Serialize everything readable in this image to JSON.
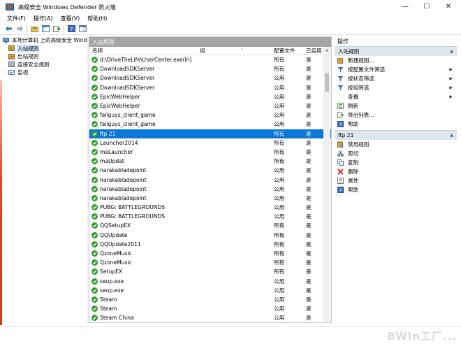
{
  "window": {
    "title": "高级安全 Windows Defender 防火墙",
    "controls": {
      "minimize": "—",
      "maximize": "☐",
      "close": "✕"
    }
  },
  "menu": [
    "文件(F)",
    "操作(A)",
    "查看(V)",
    "帮助(H)"
  ],
  "toolbar": {
    "icons": [
      "back-icon",
      "forward-icon",
      "folder-up-icon",
      "show-hide-tree-icon",
      "export-icon",
      "help-icon",
      "console-pane-icon"
    ]
  },
  "tree": {
    "root": "本地计算机 上的高级安全 Windows Defender 防火墙",
    "items": [
      {
        "label": "入站规则",
        "selected": true
      },
      {
        "label": "出站规则",
        "selected": false
      },
      {
        "label": "连接安全规则",
        "selected": false
      },
      {
        "label": "监视",
        "selected": false
      }
    ]
  },
  "center": {
    "header": "入站规则",
    "columns": {
      "name": "名称",
      "group": "组",
      "profile": "配置文件",
      "enabled": "已启用"
    },
    "rules": [
      {
        "name": "d:\\DriveTheLife\\UserCenter.exe(ln)",
        "group": "",
        "profile": "所有",
        "enabled": "是"
      },
      {
        "name": "DownloadSDKServer",
        "group": "",
        "profile": "所有",
        "enabled": "是"
      },
      {
        "name": "DownloadSDKServer",
        "group": "",
        "profile": "公用",
        "enabled": "是"
      },
      {
        "name": "DownloadSDKServer",
        "group": "",
        "profile": "公用",
        "enabled": "是"
      },
      {
        "name": "EpicWebHelper",
        "group": "",
        "profile": "公用",
        "enabled": "是"
      },
      {
        "name": "EpicWebHelper",
        "group": "",
        "profile": "公用",
        "enabled": "是"
      },
      {
        "name": "fallguys_client_game",
        "group": "",
        "profile": "公用",
        "enabled": "是"
      },
      {
        "name": "fallguys_client_game",
        "group": "",
        "profile": "公用",
        "enabled": "是"
      },
      {
        "name": "ftp 21",
        "group": "",
        "profile": "所有",
        "enabled": "是",
        "selected": true
      },
      {
        "name": "Launcher2014",
        "group": "",
        "profile": "所有",
        "enabled": "是"
      },
      {
        "name": "maLauncher",
        "group": "",
        "profile": "所有",
        "enabled": "是"
      },
      {
        "name": "maUpdat",
        "group": "",
        "profile": "所有",
        "enabled": "是"
      },
      {
        "name": "narakabladepoint",
        "group": "",
        "profile": "公用",
        "enabled": "是"
      },
      {
        "name": "narakabladepoint",
        "group": "",
        "profile": "公用",
        "enabled": "是"
      },
      {
        "name": "narakabladepoint",
        "group": "",
        "profile": "公用",
        "enabled": "是"
      },
      {
        "name": "narakabladepoint",
        "group": "",
        "profile": "公用",
        "enabled": "是"
      },
      {
        "name": "PUBG: BATTLEGROUNDS",
        "group": "",
        "profile": "公用",
        "enabled": "是"
      },
      {
        "name": "PUBG: BATTLEGROUNDS",
        "group": "",
        "profile": "公用",
        "enabled": "是"
      },
      {
        "name": "QQSetupEX",
        "group": "",
        "profile": "所有",
        "enabled": "是"
      },
      {
        "name": "QQUpdate",
        "group": "",
        "profile": "所有",
        "enabled": "是"
      },
      {
        "name": "QQUpdate2011",
        "group": "",
        "profile": "所有",
        "enabled": "是"
      },
      {
        "name": "QzoneMusic",
        "group": "",
        "profile": "所有",
        "enabled": "是"
      },
      {
        "name": "QzoneMusic",
        "group": "",
        "profile": "所有",
        "enabled": "是"
      },
      {
        "name": "SetupEX",
        "group": "",
        "profile": "所有",
        "enabled": "是"
      },
      {
        "name": "seup.exe",
        "group": "",
        "profile": "公用",
        "enabled": "是"
      },
      {
        "name": "seup.exe",
        "group": "",
        "profile": "公用",
        "enabled": "是"
      },
      {
        "name": "Steam",
        "group": "",
        "profile": "公用",
        "enabled": "是"
      },
      {
        "name": "Steam",
        "group": "",
        "profile": "公用",
        "enabled": "是"
      },
      {
        "name": "Steam China",
        "group": "",
        "profile": "公用",
        "enabled": "是"
      }
    ]
  },
  "actions": {
    "title": "操作",
    "section1": {
      "label": "入站规则",
      "items": [
        {
          "label": "新建规则...",
          "icon": "new-rule-icon",
          "submenu": false
        },
        {
          "label": "按配置文件筛选",
          "icon": "filter-icon",
          "submenu": true
        },
        {
          "label": "按状态筛选",
          "icon": "filter-icon",
          "submenu": true
        },
        {
          "label": "按组筛选",
          "icon": "filter-icon",
          "submenu": true
        },
        {
          "label": "查看",
          "icon": "",
          "submenu": true
        },
        {
          "label": "刷新",
          "icon": "refresh-icon",
          "submenu": false
        },
        {
          "label": "导出列表...",
          "icon": "export-list-icon",
          "submenu": false
        },
        {
          "label": "帮助",
          "icon": "help-icon",
          "submenu": false
        }
      ]
    },
    "section2": {
      "label": "ftp 21",
      "items": [
        {
          "label": "禁用规则",
          "icon": "disable-rule-icon"
        },
        {
          "label": "剪切",
          "icon": "cut-icon"
        },
        {
          "label": "复制",
          "icon": "copy-icon"
        },
        {
          "label": "删除",
          "icon": "delete-icon"
        },
        {
          "label": "属性",
          "icon": "properties-icon"
        },
        {
          "label": "帮助",
          "icon": "help-icon"
        }
      ]
    }
  },
  "watermark": "BWIn工厂..."
}
